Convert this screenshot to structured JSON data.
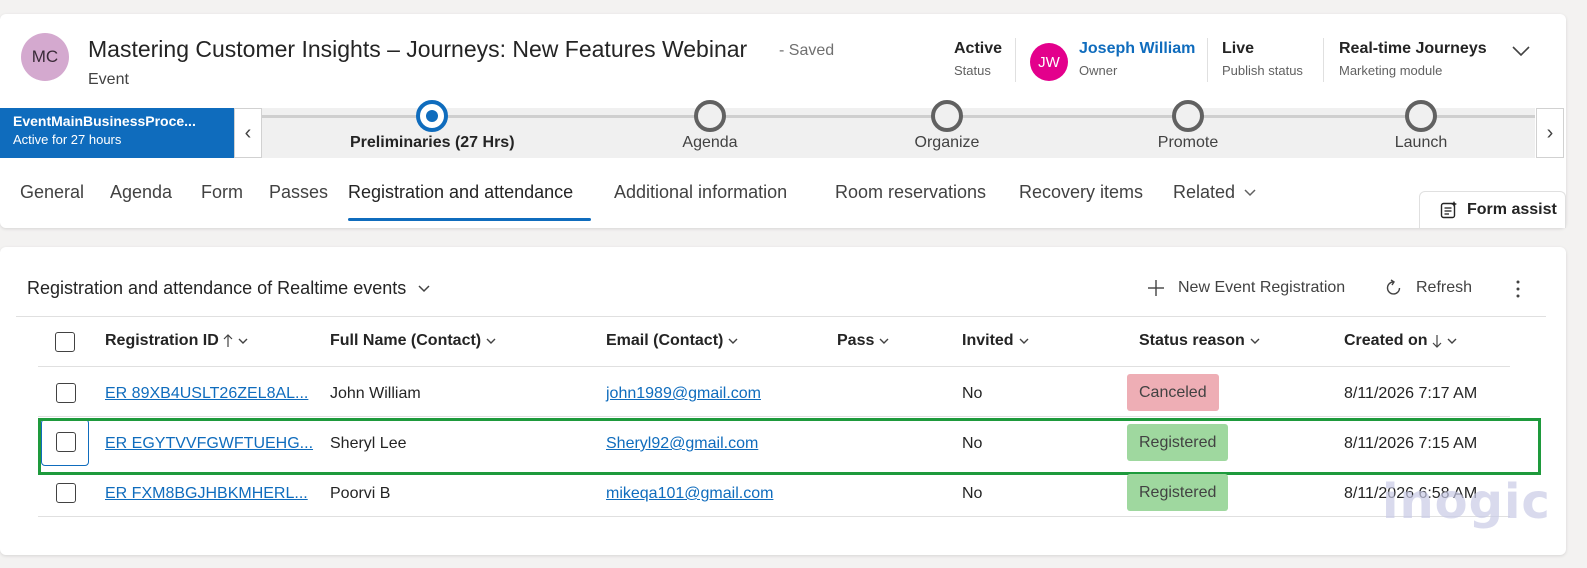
{
  "header": {
    "avatar_initials": "MC",
    "title": "Mastering Customer Insights – Journeys: New Features Webinar",
    "save_state": "- Saved",
    "entity": "Event",
    "fields": [
      {
        "value": "Active",
        "label": "Status"
      },
      {
        "value": "Joseph William",
        "label": "Owner",
        "initials": "JW"
      },
      {
        "value": "Live",
        "label": "Publish status"
      },
      {
        "value": "Real-time Journeys",
        "label": "Marketing module"
      }
    ]
  },
  "bpf": {
    "process_name": "EventMainBusinessProce...",
    "active_duration": "Active for 27 hours",
    "stages": [
      {
        "label": "Preliminaries  (27 Hrs)",
        "active": true
      },
      {
        "label": "Agenda",
        "active": false
      },
      {
        "label": "Organize",
        "active": false
      },
      {
        "label": "Promote",
        "active": false
      },
      {
        "label": "Launch",
        "active": false
      }
    ]
  },
  "tabs": [
    "General",
    "Agenda",
    "Form",
    "Passes",
    "Registration and attendance",
    "Additional information",
    "Room reservations",
    "Recovery items",
    "Related"
  ],
  "selected_tab": "Registration and attendance",
  "form_assist_label": "Form assist",
  "grid": {
    "title": "Registration and attendance of Realtime events",
    "new_label": "New Event Registration",
    "refresh_label": "Refresh",
    "columns": [
      "Registration ID",
      "Full Name (Contact)",
      "Email (Contact)",
      "Pass",
      "Invited",
      "Status reason",
      "Created on"
    ],
    "rows": [
      {
        "id": "ER 89XB4USLT26ZEL8AL...",
        "name": "John William",
        "email": "john1989@gmail.com",
        "pass": "",
        "invited": "No",
        "status": "Canceled",
        "created": "8/11/2026 7:17 AM"
      },
      {
        "id": "ER EGYTVVFGWFTUEHG...",
        "name": "Sheryl Lee",
        "email": "Sheryl92@gmail.com",
        "pass": "",
        "invited": "No",
        "status": "Registered",
        "created": "8/11/2026 7:15 AM"
      },
      {
        "id": "ER FXM8BGJHBKMHERL...",
        "name": "Poorvi B",
        "email": "mikeqa101@gmail.com",
        "pass": "",
        "invited": "No",
        "status": "Registered",
        "created": "8/11/2026 6:58 AM"
      }
    ]
  },
  "watermark": "inogic",
  "colors": {
    "accent": "#0f6cbd",
    "highlight": "#1e9a3c",
    "canceled": "#eeaeb5",
    "registered": "#9fd89f",
    "owner_avatar": "#e3008c",
    "record_avatar": "#d4a9cf"
  }
}
